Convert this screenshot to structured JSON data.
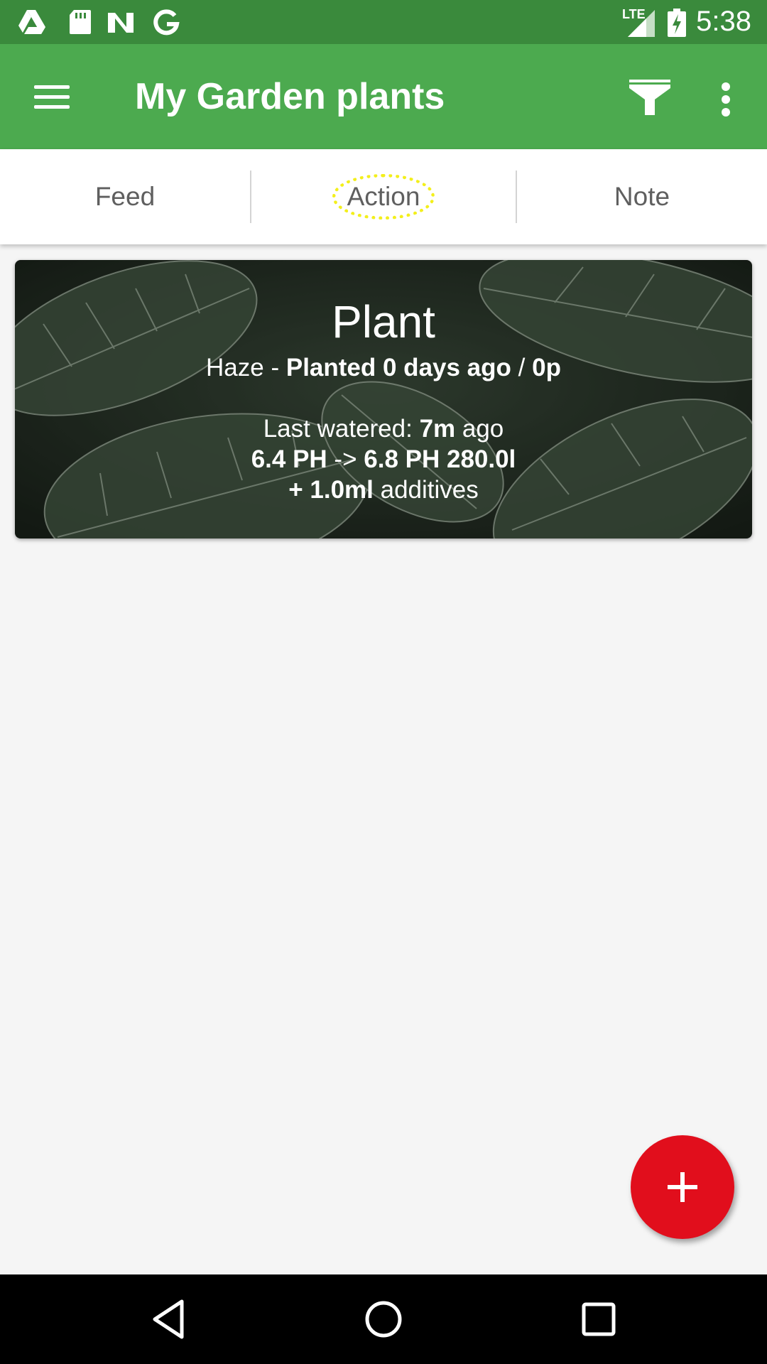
{
  "status_bar": {
    "time": "5:38",
    "network_label": "LTE",
    "icons": [
      "drive-icon",
      "sd-card-icon",
      "n-app-icon",
      "google-icon",
      "signal-icon",
      "battery-charging-icon"
    ]
  },
  "app_bar": {
    "title": "My Garden plants",
    "icons": [
      "menu-icon",
      "filter-icon",
      "more-vert-icon"
    ]
  },
  "tabs": [
    {
      "label": "Feed"
    },
    {
      "label": "Action"
    },
    {
      "label": "Note"
    }
  ],
  "plant_card": {
    "title": "Plant",
    "strain": "Haze",
    "strain_sep": " - ",
    "planted": "Planted 0 days ago",
    "planted_sep": " / ",
    "period": "0p",
    "watered_prefix": "Last watered: ",
    "watered_value": "7m",
    "watered_suffix": " ago",
    "ph_in": "6.4 PH",
    "ph_arrow": " -> ",
    "ph_out": "6.8 PH 280.0l",
    "additives_value": "+ 1.0ml",
    "additives_suffix": " additives"
  },
  "fab": {
    "icon": "add-icon"
  },
  "nav_bar": {
    "icons": [
      "back-icon",
      "home-icon",
      "recents-icon"
    ]
  },
  "colors": {
    "status_bar": "#3a8a3c",
    "app_bar": "#4caa4f",
    "fab": "#e10e1c",
    "tab_highlight": "#f3ef1b"
  }
}
